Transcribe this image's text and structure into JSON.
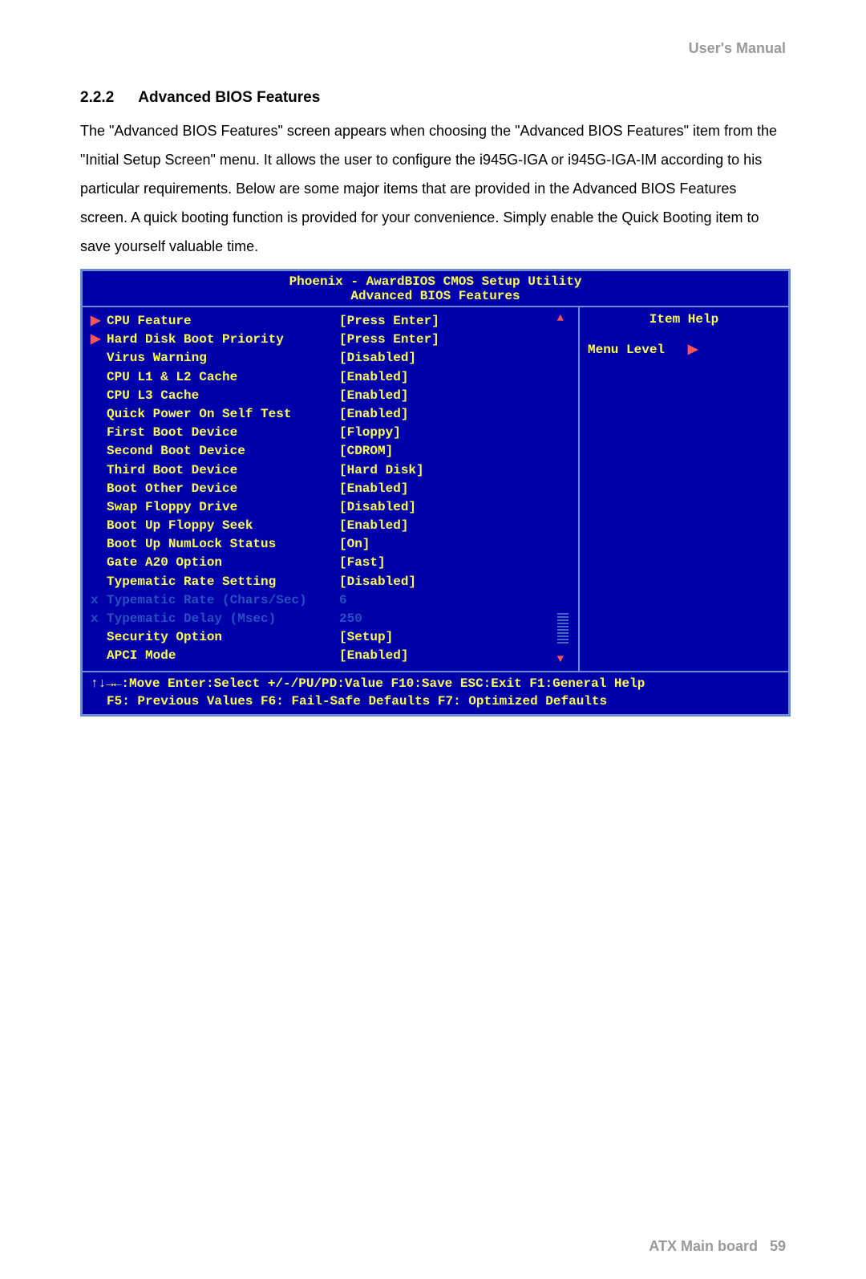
{
  "header": "User's  Manual",
  "section": {
    "num": "2.2.2",
    "title": "Advanced BIOS Features",
    "body": "The \"Advanced BIOS Features\" screen appears when choosing the \"Advanced BIOS Features\" item from the \"Initial Setup Screen\" menu. It allows the user to configure the i945G-IGA or i945G-IGA-IM according to his particular requirements. Below are some major items that are provided in the Advanced BIOS Features screen. A quick booting function is provided for your convenience. Simply enable the Quick Booting item to save yourself valuable time."
  },
  "bios": {
    "title1": "Phoenix - AwardBIOS CMOS Setup Utility",
    "title2": "Advanced BIOS Features",
    "rows": [
      {
        "marker": "▶",
        "label": "CPU Feature",
        "value": "[Press Enter]",
        "style": "norm"
      },
      {
        "marker": "▶",
        "label": "Hard Disk Boot Priority",
        "value": "[Press Enter]",
        "style": "norm"
      },
      {
        "marker": "",
        "label": "Virus Warning",
        "value": "[Disabled]",
        "style": "norm"
      },
      {
        "marker": "",
        "label": "CPU L1 & L2 Cache",
        "value": "[Enabled]",
        "style": "norm"
      },
      {
        "marker": "",
        "label": "CPU L3 Cache",
        "value": "[Enabled]",
        "style": "norm"
      },
      {
        "marker": "",
        "label": "Quick Power On Self Test",
        "value": "[Enabled]",
        "style": "norm"
      },
      {
        "marker": "",
        "label": "First Boot Device",
        "value": "[Floppy]",
        "style": "norm"
      },
      {
        "marker": "",
        "label": "Second Boot Device",
        "value": "[CDROM]",
        "style": "norm"
      },
      {
        "marker": "",
        "label": "Third Boot Device",
        "value": "[Hard Disk]",
        "style": "norm"
      },
      {
        "marker": "",
        "label": "Boot Other Device",
        "value": "[Enabled]",
        "style": "norm"
      },
      {
        "marker": "",
        "label": "Swap Floppy Drive",
        "value": "[Disabled]",
        "style": "norm"
      },
      {
        "marker": "",
        "label": "Boot Up Floppy Seek",
        "value": "[Enabled]",
        "style": "norm"
      },
      {
        "marker": "",
        "label": "Boot Up NumLock Status",
        "value": "[On]",
        "style": "norm"
      },
      {
        "marker": "",
        "label": "Gate A20 Option",
        "value": "[Fast]",
        "style": "norm"
      },
      {
        "marker": "",
        "label": "Typematic Rate Setting",
        "value": "[Disabled]",
        "style": "norm"
      },
      {
        "marker": "x",
        "label": "Typematic Rate (Chars/Sec)",
        "value": "6",
        "style": "dim"
      },
      {
        "marker": "x",
        "label": "Typematic Delay (Msec)",
        "value": "250",
        "style": "dim"
      },
      {
        "marker": "",
        "label": "Security Option",
        "value": "[Setup]",
        "style": "norm"
      },
      {
        "marker": "",
        "label": "APCI Mode",
        "value": "[Enabled]",
        "style": "norm"
      }
    ],
    "help": {
      "title": "Item Help",
      "level_label": "Menu Level",
      "level_arrow": "▶"
    },
    "footer": {
      "line1": "↑↓→←:Move  Enter:Select  +/-/PU/PD:Value  F10:Save  ESC:Exit  F1:General Help",
      "line2": "F5: Previous Values    F6: Fail-Safe Defaults    F7: Optimized Defaults"
    }
  },
  "footer": {
    "text": "ATX  Main  board",
    "page": "59"
  }
}
